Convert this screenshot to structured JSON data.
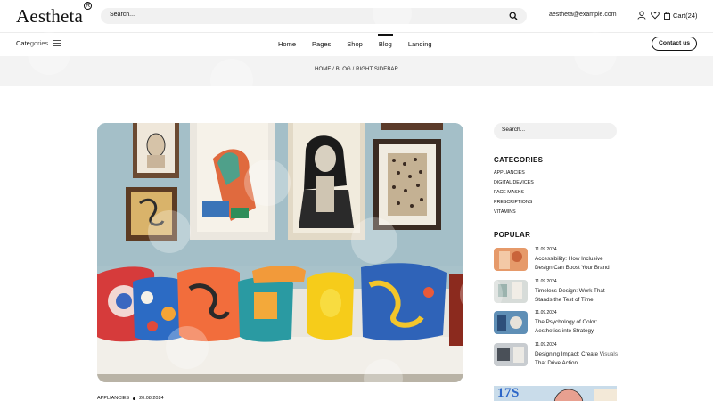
{
  "brand": {
    "name": "Aestheta",
    "mark": "R"
  },
  "header": {
    "search_placeholder": "Search...",
    "email": "aestheta@example.com",
    "cart_label": "Cart(24)"
  },
  "nav": {
    "categories_label": "Categories",
    "items": [
      "Home",
      "Pages",
      "Shop",
      "Blog",
      "Landing"
    ],
    "active": "Blog",
    "contact_label": "Contact us"
  },
  "breadcrumb": "HOME / BLOG / RIGHT SIDEBAR",
  "post": {
    "category": "APPLIANCIES",
    "date": "20.08.2024"
  },
  "sidebar": {
    "search_placeholder": "Search...",
    "categories_heading": "CATEGORIES",
    "categories": [
      "Appliancies",
      "Digital devices",
      "Face masks",
      "Prescriptions",
      "Vitamins"
    ],
    "popular_heading": "POPULAR",
    "popular": [
      {
        "date": "11.09.2024",
        "title": "Accessibility: How Inclusive Design Can Boost Your Brand"
      },
      {
        "date": "11.09.2024",
        "title": "Timeless Design: Work That Stands the Test of Time"
      },
      {
        "date": "11.09.2024",
        "title": "The Psychology of Color: Aesthetics into Strategy"
      },
      {
        "date": "11.09.2024",
        "title": "Designing Impact: Create Visuals That Drive Action"
      }
    ],
    "banner_text": "17S"
  },
  "watermark": "QODE interactive",
  "colors": {
    "accent": "#111111",
    "band": "#f3f3f3",
    "field": "#f1f1f1",
    "banner": "#c9dcea",
    "banner_text": "#2c66c8"
  }
}
